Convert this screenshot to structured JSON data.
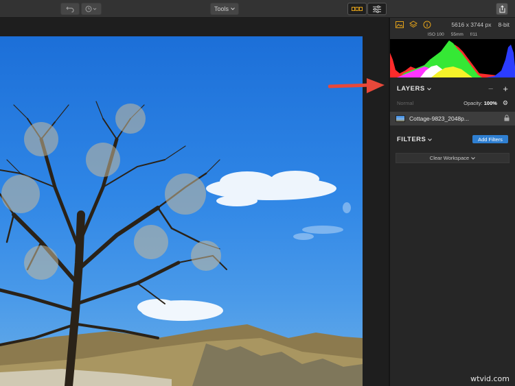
{
  "toolbar": {
    "tools_label": "Tools",
    "undo_icon": "undo-icon",
    "history_icon": "clock-icon",
    "view_a_icon": "compare-view-icon",
    "view_b_icon": "adjust-sliders-icon",
    "share_icon": "share-icon"
  },
  "panel": {
    "tab_icons": [
      "image-info-icon",
      "layers-icon",
      "info-icon"
    ],
    "accent_color": "#e3a21a",
    "dimensions": "5616 x 3744 px",
    "bit_depth": "8-bit",
    "exif": {
      "iso": "ISO 100",
      "focal": "55mm",
      "aperture": "f/11"
    },
    "layers": {
      "title": "LAYERS",
      "minus": "−",
      "plus": "+",
      "blend_mode": "Normal",
      "opacity_label": "Opacity:",
      "opacity_value": "100%",
      "items": [
        {
          "name": "Cottage-9823_2048p..."
        }
      ]
    },
    "filters": {
      "title": "FILTERS",
      "add_label": "Add Filters",
      "button_color": "#2f7fd1"
    },
    "clear_workspace": "Clear Workspace"
  },
  "watermark": "wtvid.com"
}
